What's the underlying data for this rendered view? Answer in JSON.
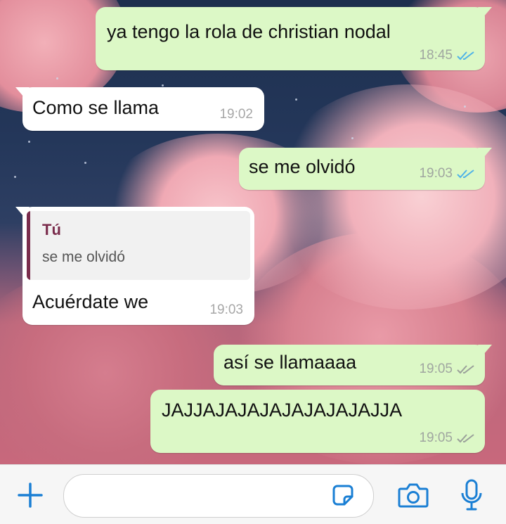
{
  "messages": [
    {
      "direction": "outgoing",
      "text": "ya tengo la rola de christian nodal",
      "time": "18:45",
      "status": "read"
    },
    {
      "direction": "incoming",
      "text": "Como se llama",
      "time": "19:02"
    },
    {
      "direction": "outgoing",
      "text": "se me olvidó",
      "time": "19:03",
      "status": "read"
    },
    {
      "direction": "incoming",
      "text": "Acuérdate we",
      "time": "19:03",
      "quoted": {
        "author": "Tú",
        "text": "se me olvidó"
      }
    },
    {
      "direction": "outgoing",
      "text": "así se llamaaaa",
      "time": "19:05",
      "status": "delivered"
    },
    {
      "direction": "outgoing",
      "text": "JAJJAJAJAJAJAJAJAJAJJA",
      "time": "19:05",
      "status": "delivered"
    }
  ],
  "colors": {
    "outgoing_bubble": "#dcf8c6",
    "incoming_bubble": "#ffffff",
    "read_ticks": "#4fb3e8",
    "delivered_ticks": "#9aa09a",
    "accent": "#1a7fd4",
    "quote_author": "#7a2c4c"
  },
  "input_bar": {
    "icons": [
      "plus-icon",
      "sticker-icon",
      "camera-icon",
      "microphone-icon"
    ],
    "placeholder": ""
  }
}
